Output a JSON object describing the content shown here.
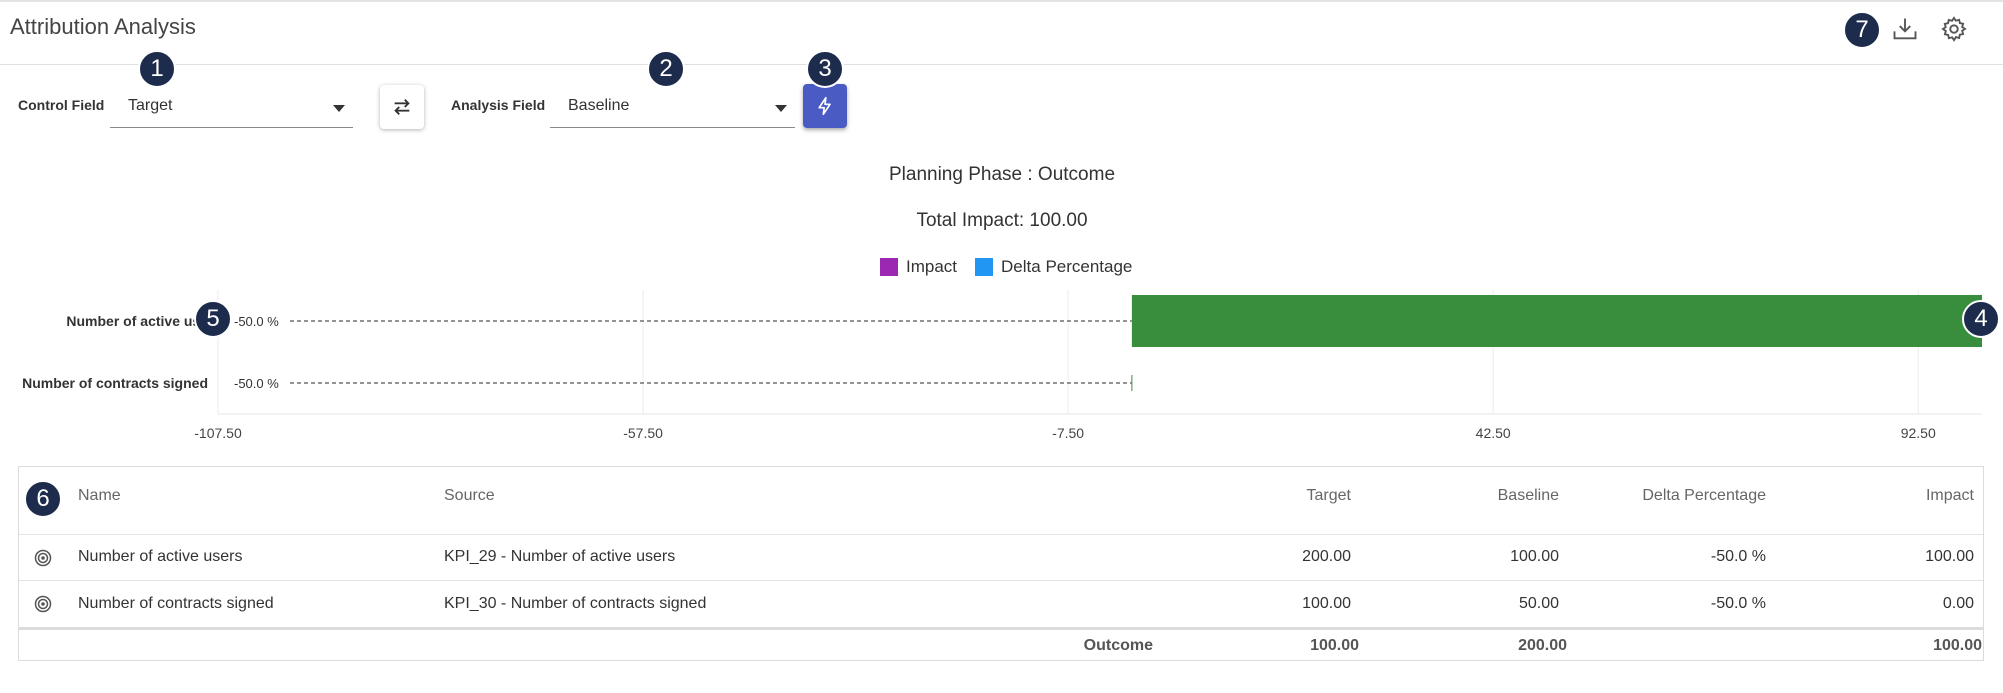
{
  "header": {
    "title": "Attribution Analysis"
  },
  "controls": {
    "control_field_label": "Control Field",
    "control_field_value": "Target",
    "analysis_field_label": "Analysis Field",
    "analysis_field_value": "Baseline"
  },
  "badges": [
    "1",
    "2",
    "3",
    "4",
    "5",
    "6",
    "7"
  ],
  "chart_data": {
    "type": "bar",
    "orientation": "horizontal",
    "title": "Planning Phase : Outcome",
    "subtitle": "Total Impact: 100.00",
    "legend": [
      {
        "name": "Impact",
        "color": "#9c27b0"
      },
      {
        "name": "Delta Percentage",
        "color": "#2196f3"
      }
    ],
    "legend_position": "top-center",
    "categories": [
      "Number of active users",
      "Number of contracts signed"
    ],
    "category_labels_display": [
      "Number of active use",
      "Number of contracts signed"
    ],
    "bar_values": [
      100,
      0
    ],
    "bar_start": 0,
    "bar_color": "#388e3c",
    "point_labels": [
      "-50.0 %",
      "-50.0 %"
    ],
    "x_ticks": [
      -107.5,
      -57.5,
      -7.5,
      42.5,
      92.5
    ],
    "x_tick_labels": [
      "-107.50",
      "-57.50",
      "-7.50",
      "42.50",
      "92.50"
    ],
    "xlim": [
      -107.5,
      100
    ],
    "grid": true
  },
  "table": {
    "columns": [
      "Name",
      "Source",
      "Target",
      "Baseline",
      "Delta Percentage",
      "Impact"
    ],
    "rows": [
      {
        "name": "Number of active users",
        "source": "KPI_29 - Number of active users",
        "target": "200.00",
        "baseline": "100.00",
        "delta": "-50.0 %",
        "impact": "100.00"
      },
      {
        "name": "Number of contracts signed",
        "source": "KPI_30 - Number of contracts signed",
        "target": "100.00",
        "baseline": "50.00",
        "delta": "-50.0 %",
        "impact": "0.00"
      }
    ],
    "footer": {
      "label": "Outcome",
      "target": "100.00",
      "baseline": "200.00",
      "impact": "100.00"
    }
  },
  "icons": {
    "download": "download-icon",
    "settings": "gear-icon",
    "swap": "swap-icon",
    "run": "lightning-icon",
    "row": "target-icon"
  },
  "colors": {
    "accent": "#4a5bc4",
    "badge": "#1d2b4c"
  }
}
